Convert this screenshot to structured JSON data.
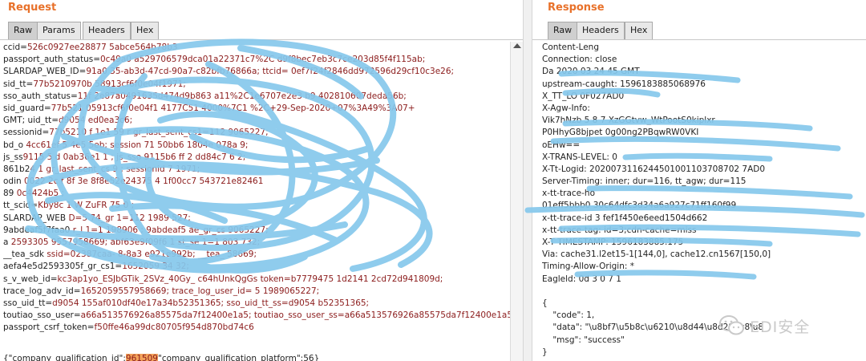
{
  "request": {
    "title": "Request",
    "tabs": [
      "Raw",
      "Params",
      "Headers",
      "Hex"
    ],
    "active_tab": "Raw",
    "lines": [
      {
        "k": "ccid=",
        "v": "526c0927ee28877 5abce564b78b3"
      },
      {
        "k": "passport_auth_status=",
        "v": "0c49a0 a529706579dca01a22371c7%2C d9f8bec7eb3c7ce203d85f4f115ab;"
      },
      {
        "k": "SLARDAP_WEB_ID=",
        "v": "91a0 35-ab3d-47cd-90a7-c82bfb76866a; ttcid= 0ef7f24f2846dd972596d29cf10c3e26;"
      },
      {
        "k": "sid_tt=",
        "v": "77b5210970b 58913cf6f0e04f1971;"
      },
      {
        "k": "sso_auth_status=",
        "v": "11f 2e87a0491635d474d9b863 a11%2C1e6707e2e3 b9 402810607deda56b;"
      },
      {
        "k": "sid_guard=",
        "v": "77b521 05913cf6f0e04f1 4177C51 4000%7C1 %2C+29-Sep-2020+07%3A49%3A07+"
      },
      {
        "k": "GMT; uid_tt=",
        "v": "d9054 ed0ea3c6;"
      },
      {
        "k": "sessionid=",
        "v": "77b5210 f 1e1 59 r gr_last_sent_cs1=112 9065227;"
      },
      {
        "k": "bd_o ",
        "v": "4cc61ef 5 4e5 5eb; session 71 50bb6 1804e 078a 9;"
      },
      {
        "k": "js_ss",
        "v": "9115 5 d 0ab36e1 1 ; js_sso 9115b6 ff 2 dd84c7 6 2;"
      },
      {
        "k": "861b2",
        "v": "4 1 gr_last_sent_cs 9 ; sessionid 7 1971;"
      },
      {
        "k": "odin ",
        "v": "0022 2c f 8f 3e 8f8e52e24375 4 1f00cc7 543721e82461"
      },
      {
        "k": "89 ",
        "v": "0c4424b5 ;"
      },
      {
        "k": "tt_scid=",
        "v": "Kby8c 1 W ZuFR 75 0 ;"
      },
      {
        "k": "SLARDAP_WEB ",
        "v": "D=5 74_gr 1=112 1989 527;"
      },
      {
        "k": "9abdeaf5f7faa0 ",
        "v": "r_l 1=1 198906 ; 9abdeaf5 ae_gr_cs 9065227;"
      },
      {
        "k": "a ",
        "v": "2593305 9557958669; abf63e9f09f6 1 st_se 1=1 803 732;"
      },
      {
        "k": "__tea_sdk ",
        "v": "ssid=02387caa- 8-8a3 e921e992b; __tea_ 58669;"
      },
      {
        "k": "aefa4e5d2593305f_gr_cs1=",
        "v": "1652059 34 32;"
      },
      {
        "k": "s_v_web_id=",
        "v": "kc3ap1yo_ESJbGTik_2SVz_40Gy_ c64hUnkQgGs token=b7779475 1d2141 2cd72d941809d;"
      },
      {
        "k": "trace_log_adv_id=",
        "v": "1652059557958669; trace_log_user_id= 5 1989065227;"
      },
      {
        "k": "sso_uid_tt=",
        "v": "d9054 155af010df40e17a34b52351365; sso_uid_tt_ss=d9054 b52351365;"
      },
      {
        "k": "toutiao_sso_user=",
        "v": "a66a513576926a85575da7f12400e1a5; toutiao_sso_user_ss=a66a513576926a85575da7f12400e1a5;"
      },
      {
        "k": "passport_csrf_token=",
        "v": "f50ffe46a99dc80705f954d870bd74c6"
      }
    ],
    "body_prefix": "{\"company_qualification_id\":",
    "body_selected": "961509",
    "body_suffix": "\"company_qualification_platform\":56}"
  },
  "response": {
    "title": "Response",
    "tabs": [
      "Raw",
      "Headers",
      "Hex"
    ],
    "active_tab": "Raw",
    "lines": [
      "Content-Leng",
      "Connection: close",
      "Da 2020 03 24 45 GMT",
      "upstream-caught: 1596183885068976",
      "X_TT_LO 0F027AD0",
      "X-Agw-Info:",
      "Vik7hNzb 5 8 7 XzGGtvw_WtPootS0kiplxr",
      "P0HhyG8bjpet 0g00ng2PBqwRW0VKI",
      "oEHw==",
      "X-TRANS-LEVEL: 0",
      "X-Tt-Logid: 2020073116244501001103708702 7AD0",
      "Server-Timing: inner; dur=116, tt_agw; dur=115",
      "x-tt-trace-ho",
      "01eff5bbb0 30c64dfc3d34a6a927c71ff160f99",
      "x-tt-trace-id 3 fef1f450e6eed1504d662",
      "x-tt-trace-tag: id=3;cdn-cache=miss",
      "X-T  TIMESTAMP: 1596183885.175",
      "Via: cache31.l2et15-1[144,0], cache12.cn1567[150,0]",
      "Timing-Allow-Origin: *",
      "Eagleld: 0d 3 0 7 1"
    ],
    "json_lines": [
      "{",
      "    \"code\": 1,",
      "    \"data\": \"\\u8bf7\\u5b8c\\u6210\\u8d44\\u8d28 \\u8\\u8",
      "    \"msg\": \"success\"",
      "}"
    ]
  },
  "watermark": {
    "text": "EDI安全"
  },
  "colors": {
    "title": "#e8712a",
    "value": "#8b1b1b",
    "scribble": "#86c8ec",
    "selection": "#f3a25a"
  }
}
